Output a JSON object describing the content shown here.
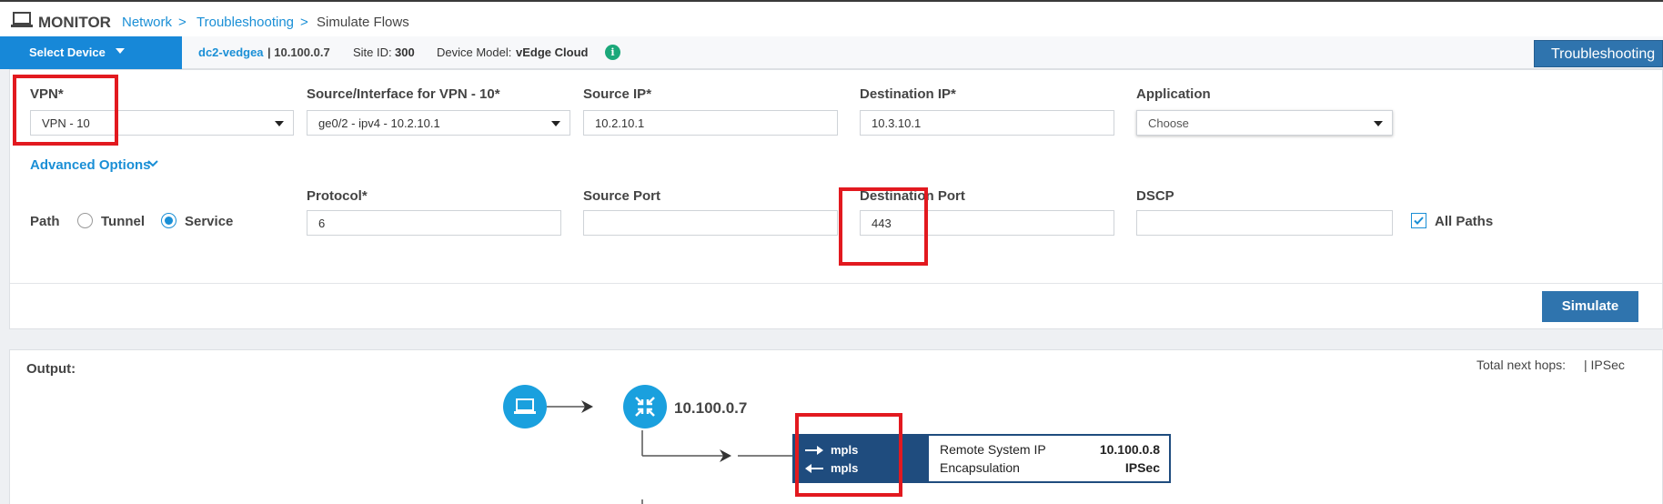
{
  "header": {
    "title": "MONITOR",
    "breadcrumb": [
      {
        "label": "Network"
      },
      {
        "label": ">"
      },
      {
        "label": "Troubleshooting"
      },
      {
        "label": ">"
      },
      {
        "label": "Simulate Flows"
      }
    ]
  },
  "device_bar": {
    "select_device": "Select Device",
    "device_name": "dc2-vedgea",
    "device_ip": "| 10.100.0.7",
    "site_label": "Site ID:",
    "site_id": "300",
    "model_label": "Device Model:",
    "model": "vEdge Cloud",
    "info_icon": "i",
    "troubleshooting_button": "Troubleshooting"
  },
  "form": {
    "vpn": {
      "label": "VPN*",
      "value": "VPN - 10"
    },
    "source_interface": {
      "label": "Source/Interface for VPN - 10*",
      "value": "ge0/2 - ipv4 - 10.2.10.1"
    },
    "source_ip": {
      "label": "Source IP*",
      "value": "10.2.10.1"
    },
    "destination_ip": {
      "label": "Destination IP*",
      "value": "10.3.10.1"
    },
    "application": {
      "label": "Application",
      "value": "Choose"
    },
    "advanced_options": "Advanced Options",
    "path": {
      "label": "Path",
      "tunnel": "Tunnel",
      "service": "Service",
      "selected": "Service"
    },
    "protocol": {
      "label": "Protocol*",
      "value": "6"
    },
    "source_port": {
      "label": "Source Port",
      "value": ""
    },
    "destination_port": {
      "label": "Destination Port",
      "value": "443"
    },
    "dscp": {
      "label": "DSCP",
      "value": ""
    },
    "all_paths": {
      "label": "All Paths",
      "checked": true
    },
    "simulate_button": "Simulate"
  },
  "output": {
    "label": "Output:",
    "total_next_hops_label": "Total next hops:",
    "total_next_hops_value": "| IPSec",
    "node_ip": "10.100.0.7",
    "tunnel": {
      "out_color": "mpls",
      "in_color": "mpls",
      "remote_system_ip_label": "Remote System IP",
      "remote_system_ip": "10.100.0.8",
      "encapsulation_label": "Encapsulation",
      "encapsulation": "IPSec"
    }
  },
  "colors": {
    "accent": "#1a8fd6",
    "button": "#2f74ae",
    "tunnel": "#1f4c7e",
    "highlight": "#e2191f",
    "node": "#1aa0de"
  }
}
